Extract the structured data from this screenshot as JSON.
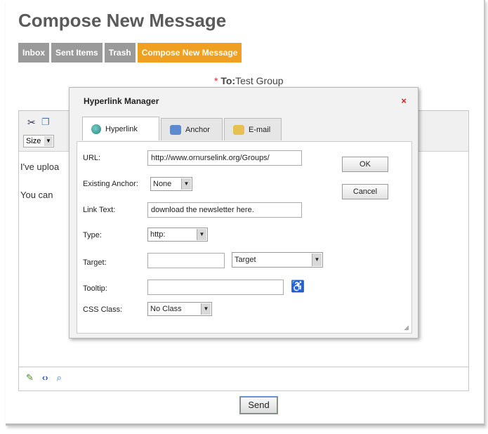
{
  "page": {
    "title": "Compose New Message"
  },
  "tabs": [
    {
      "label": "Inbox"
    },
    {
      "label": "Sent Items"
    },
    {
      "label": "Trash"
    },
    {
      "label": "Compose New Message"
    }
  ],
  "to": {
    "label": "To:",
    "value": "Test Group",
    "required_mark": "*"
  },
  "editor": {
    "size_label": "Size",
    "line1": "I've uploa",
    "line2": "You can"
  },
  "send_label": "Send",
  "dialog": {
    "title": "Hyperlink Manager",
    "close_glyph": "×",
    "tabs": [
      {
        "label": "Hyperlink"
      },
      {
        "label": "Anchor"
      },
      {
        "label": "E-mail"
      }
    ],
    "fields": {
      "url_label": "URL:",
      "url_value": "http://www.ornurselink.org/Groups/",
      "anchor_label": "Existing Anchor:",
      "anchor_value": "None",
      "link_text_label": "Link Text:",
      "link_text_value": "download the newsletter here.",
      "type_label": "Type:",
      "type_value": "http:",
      "target_label": "Target:",
      "target_value": "",
      "target_select": "Target",
      "tooltip_label": "Tooltip:",
      "tooltip_value": "",
      "css_label": "CSS Class:",
      "css_value": "No Class"
    },
    "ok_label": "OK",
    "cancel_label": "Cancel"
  }
}
